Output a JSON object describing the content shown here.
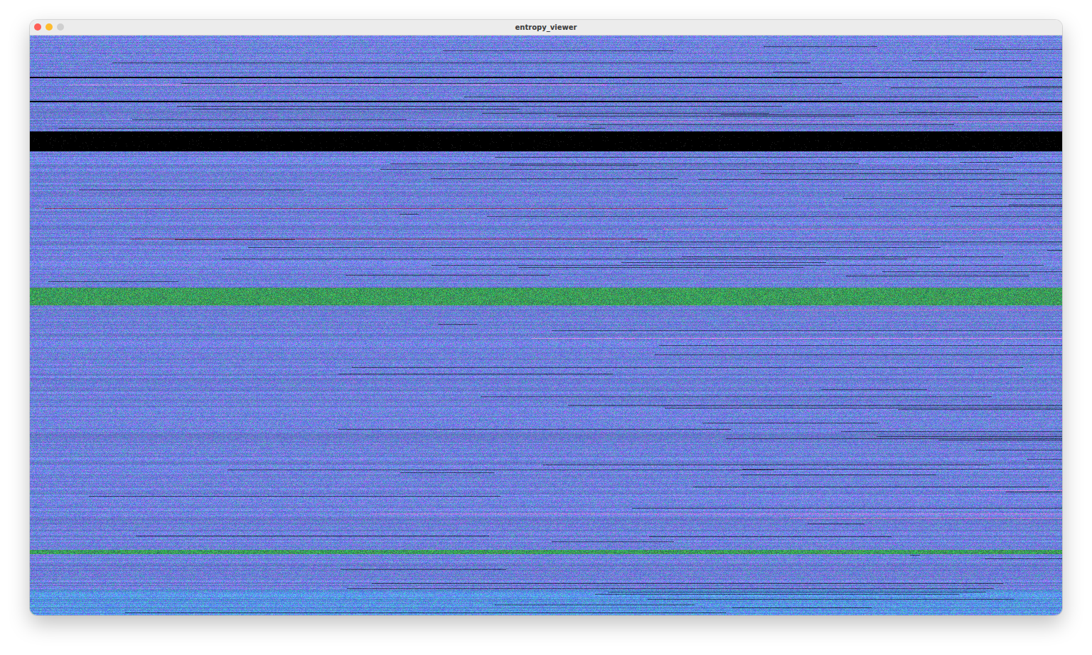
{
  "window": {
    "title": "entropy_viewer"
  }
}
